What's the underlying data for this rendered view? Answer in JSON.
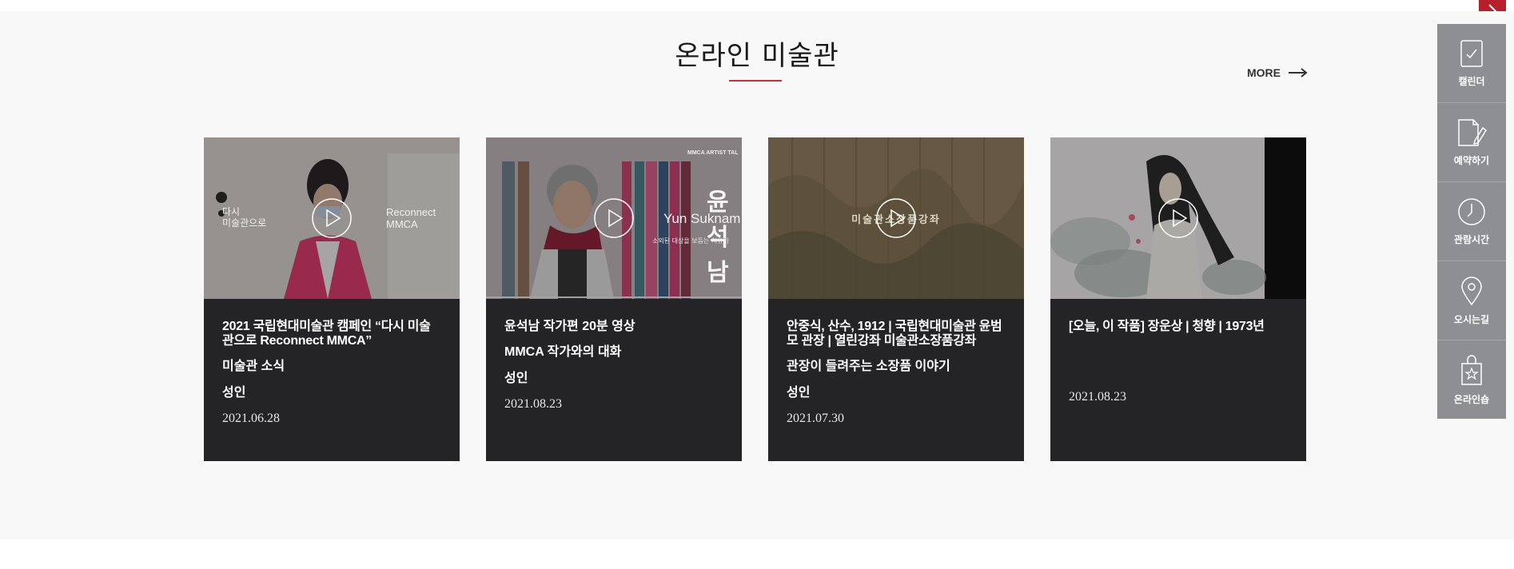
{
  "section": {
    "title": "온라인 미술관",
    "more_label": "MORE"
  },
  "cards": [
    {
      "title": "2021 국립현대미술관 캠페인 “다시 미술관으로 Reconnect MMCA”",
      "subtitle": "미술관 소식",
      "audience": "성인",
      "date": "2021.06.28",
      "thumb_text_left": "다시\n미술관으로",
      "thumb_text_right": "Reconnect\nMMCA"
    },
    {
      "title": "윤석남 작가편 20분 영상",
      "subtitle": "MMCA 작가와의 대화",
      "audience": "성인",
      "date": "2021.08.23",
      "thumb_text_top": "MMCA ARTIST TAL",
      "thumb_text_main": "윤석남",
      "thumb_text_en": "Yun Suknam",
      "thumb_text_small": "소외된 대상을 보듬는 치유가"
    },
    {
      "title": "안중식, 산수, 1912 | 국립현대미술관 윤범모 관장 | 열린강좌 미술관소장품강좌",
      "subtitle": "관장이 들려주는 소장품 이야기",
      "audience": "성인",
      "date": "2021.07.30",
      "thumb_text_main": "미술관소장품강좌"
    },
    {
      "title": "[오늘, 이 작품] 장운상 | 청향 | 1973년",
      "subtitle": "",
      "audience": "",
      "date": "2021.08.23"
    }
  ],
  "quick_menu": [
    {
      "label": "캘린더",
      "icon": "calendar-icon"
    },
    {
      "label": "예약하기",
      "icon": "reservation-icon"
    },
    {
      "label": "관람시간",
      "icon": "clock-icon"
    },
    {
      "label": "오시는길",
      "icon": "location-pin-icon"
    },
    {
      "label": "온라인숍",
      "icon": "shopping-bag-icon"
    }
  ],
  "colors": {
    "accent": "#e0262e",
    "card_bg": "#242426",
    "quick_menu_bg": "#8d8f93",
    "corner_btn": "#b5202a"
  }
}
